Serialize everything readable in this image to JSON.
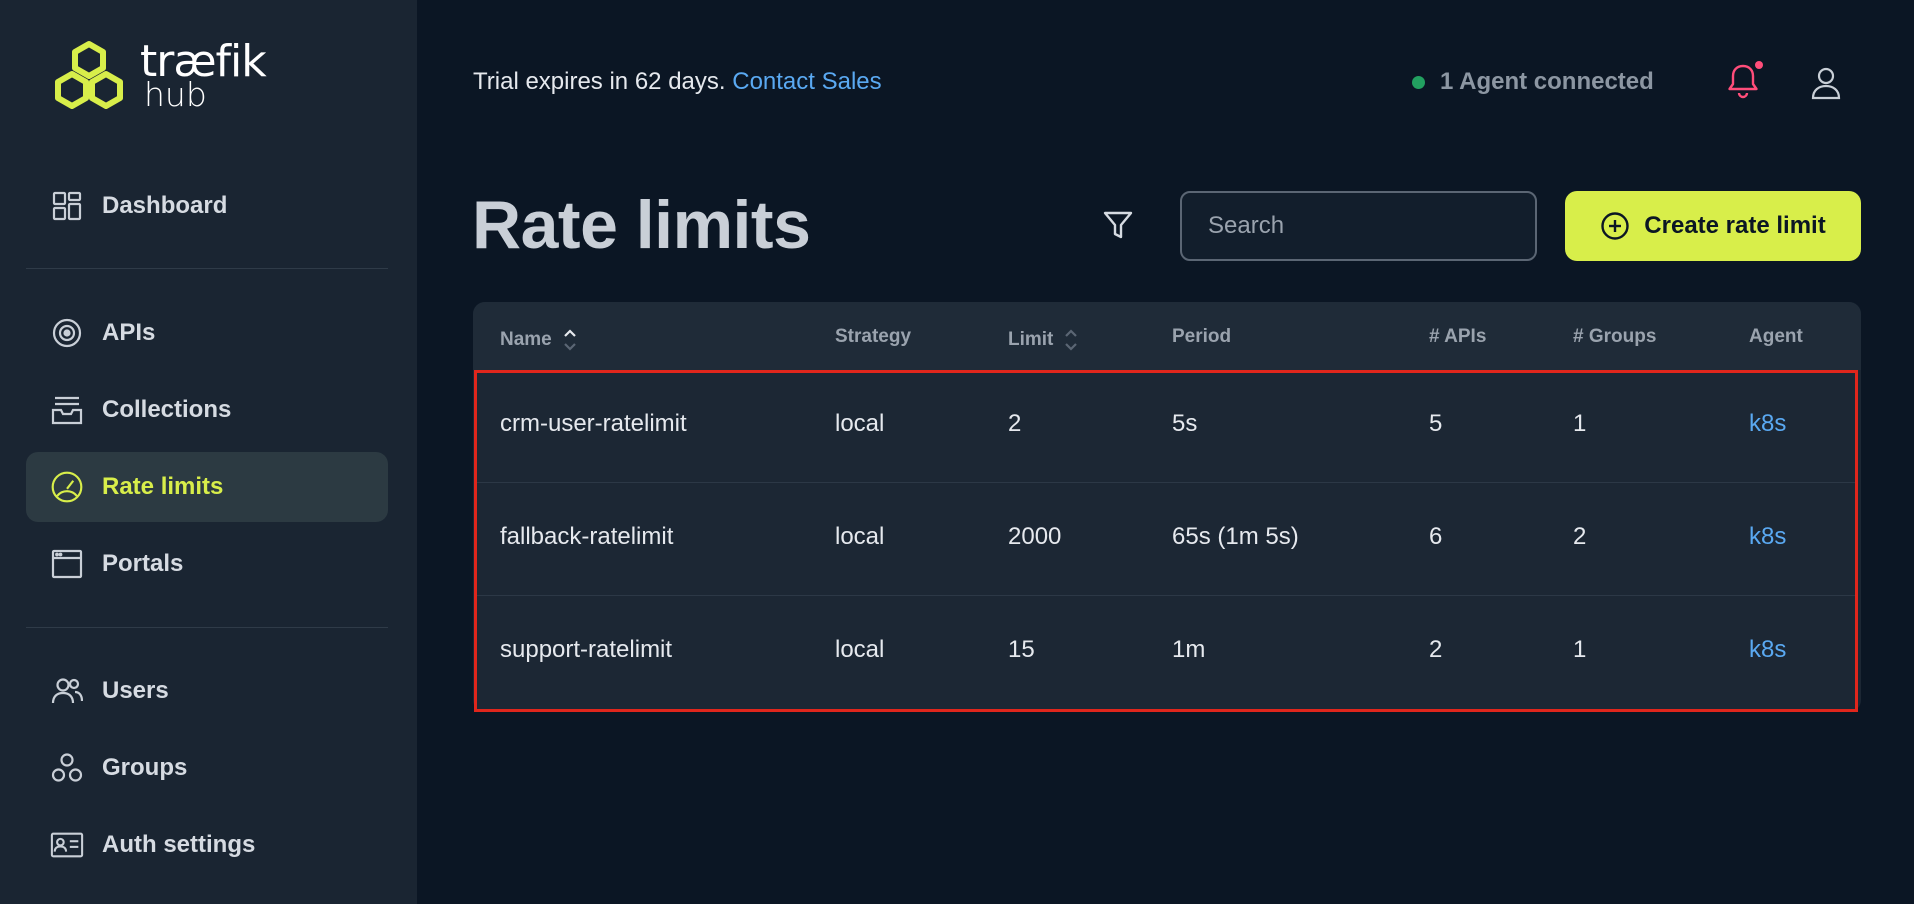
{
  "brand": {
    "word": "træfik",
    "sub": "hub"
  },
  "sidebar": {
    "items": [
      {
        "label": "Dashboard",
        "icon": "dashboard-grid-icon"
      },
      {
        "label": "APIs",
        "icon": "api-target-icon"
      },
      {
        "label": "Collections",
        "icon": "collections-stack-icon"
      },
      {
        "label": "Rate limits",
        "icon": "speedometer-icon",
        "active": true
      },
      {
        "label": "Portals",
        "icon": "browser-window-icon"
      },
      {
        "label": "Users",
        "icon": "users-icon"
      },
      {
        "label": "Groups",
        "icon": "groups-icon"
      },
      {
        "label": "Auth settings",
        "icon": "id-card-icon"
      }
    ]
  },
  "topbar": {
    "trial_text": "Trial expires in 62 days.",
    "contact_label": "Contact Sales",
    "agent_status": "1 Agent connected"
  },
  "header": {
    "title": "Rate limits",
    "search_placeholder": "Search",
    "create_label": "Create rate limit"
  },
  "table": {
    "columns": [
      "Name",
      "Strategy",
      "Limit",
      "Period",
      "# APIs",
      "# Groups",
      "Agent"
    ],
    "rows": [
      {
        "name": "crm-user-ratelimit",
        "strategy": "local",
        "limit": "2",
        "period": "5s",
        "apis": "5",
        "groups": "1",
        "agent": "k8s"
      },
      {
        "name": "fallback-ratelimit",
        "strategy": "local",
        "limit": "2000",
        "period": "65s (1m 5s)",
        "apis": "6",
        "groups": "2",
        "agent": "k8s"
      },
      {
        "name": "support-ratelimit",
        "strategy": "local",
        "limit": "15",
        "period": "1m",
        "apis": "2",
        "groups": "1",
        "agent": "k8s"
      }
    ]
  },
  "colors": {
    "accent": "#d8ee4a",
    "link": "#5aa9f2",
    "status_ok": "#22a060",
    "notification": "#ff4d7a",
    "highlight": "#e0261c"
  }
}
